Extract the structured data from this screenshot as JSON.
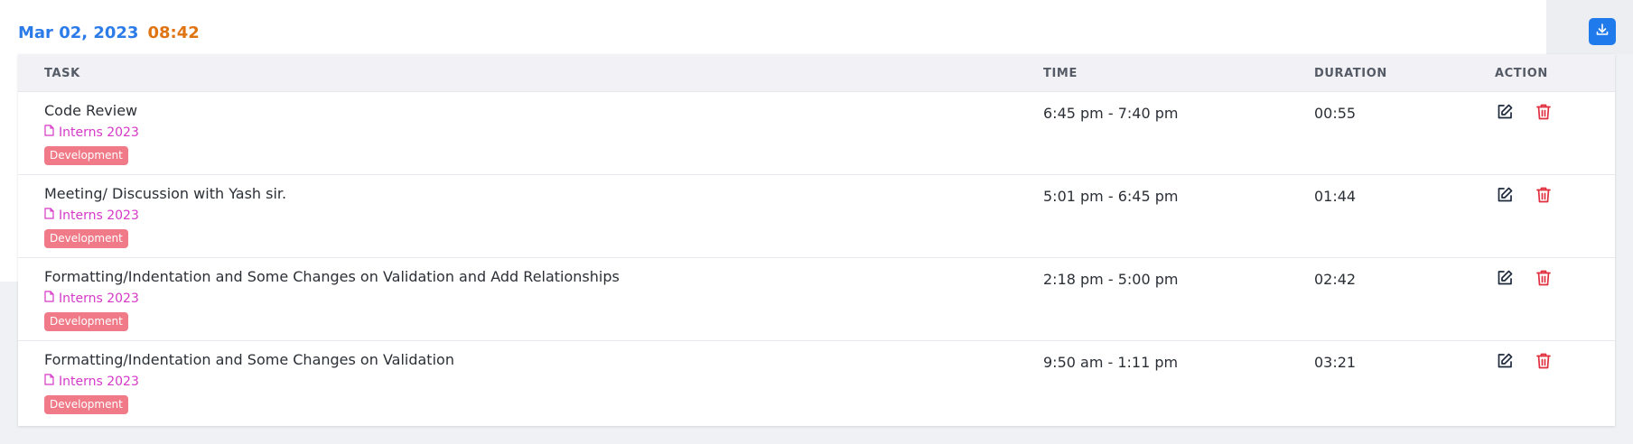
{
  "header": {
    "date": "Mar 02, 2023",
    "time": "08:42",
    "download_icon": "download-icon"
  },
  "table": {
    "columns": [
      "TASK",
      "TIME",
      "DURATION",
      "ACTION"
    ],
    "rows": [
      {
        "task": "Code Review",
        "project": "Interns 2023",
        "tag": "Development",
        "time": "6:45 pm - 7:40 pm",
        "duration": "00:55"
      },
      {
        "task": "Meeting/ Discussion with Yash sir.",
        "project": "Interns 2023",
        "tag": "Development",
        "time": "5:01 pm - 6:45 pm",
        "duration": "01:44"
      },
      {
        "task": "Formatting/Indentation and Some Changes on Validation and Add Relationships",
        "project": "Interns 2023",
        "tag": "Development",
        "time": "2:18 pm - 5:00 pm",
        "duration": "02:42"
      },
      {
        "task": "Formatting/Indentation and Some Changes on Validation",
        "project": "Interns 2023",
        "tag": "Development",
        "time": "9:50 am - 1:11 pm",
        "duration": "03:21"
      }
    ]
  },
  "colors": {
    "date": "#2b7be8",
    "time": "#e07412",
    "project": "#d638c8",
    "tag_bg": "#f07a88",
    "edit_icon": "#1f2b3d",
    "delete_icon": "#e0303f",
    "download_btn": "#1f7aec"
  }
}
